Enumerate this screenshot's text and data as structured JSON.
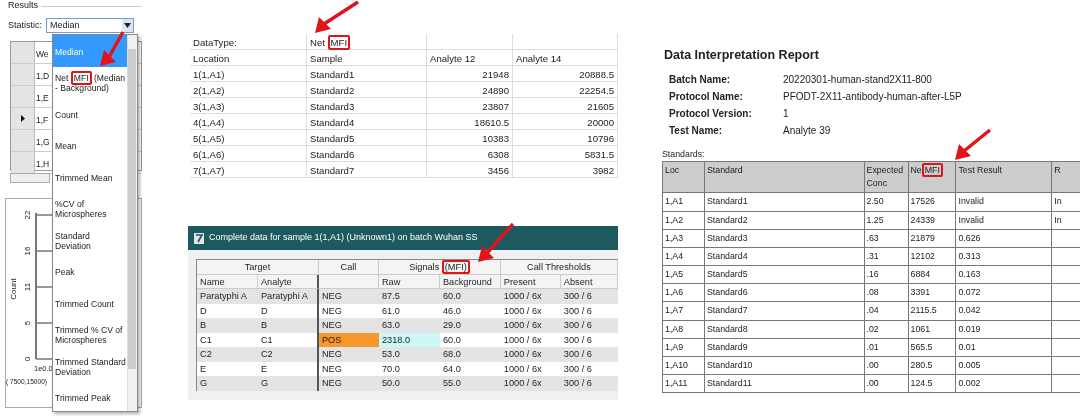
{
  "stats_panel": {
    "group_title": "Results",
    "statistic_label": "Statistic:",
    "statistic_value": "Median",
    "grid": {
      "column": "We",
      "rows": [
        {
          "label": "1,D",
          "current": false
        },
        {
          "label": "1,E",
          "current": false
        },
        {
          "label": "1,F",
          "current": true
        },
        {
          "label": "1,G",
          "current": false
        },
        {
          "label": "1,H",
          "current": false
        }
      ]
    },
    "histogram": {
      "y_label": "Count",
      "y_ticks": [
        "22",
        "16",
        "11",
        "5",
        "0"
      ],
      "x_tick": "1e0.0",
      "range": "( 7500,15000)"
    },
    "dropdown_items": [
      {
        "label": "Median",
        "selected": true
      },
      {
        "selected": false,
        "highlight": {
          "prefix": "Net ",
          "mark": "MFI",
          "suffix": " (Median - Background)"
        }
      },
      {
        "label": "Count",
        "selected": false
      },
      {
        "label": "Mean",
        "selected": false
      },
      {
        "label": "Trimmed Mean",
        "selected": false
      },
      {
        "label": "%CV of Microspheres",
        "selected": false
      },
      {
        "label": "Standard Deviation",
        "selected": false
      },
      {
        "label": "Peak",
        "selected": false
      },
      {
        "label": "Trimmed Count",
        "selected": false
      },
      {
        "label": "Trimmed % CV of Microspheres",
        "selected": false
      },
      {
        "label": "Trimmed Standard Deviation",
        "selected": false
      },
      {
        "label": "Trimmed Peak",
        "selected": false
      }
    ]
  },
  "export_sheet": {
    "data_type_label": "DataType:",
    "data_type_value": {
      "prefix": "Net ",
      "mark": "MFI"
    },
    "columns": [
      "Location",
      "Sample",
      "Analyte 12",
      "Analyte 14"
    ],
    "rows": [
      [
        "1(1,A1)",
        "Standard1",
        "21948",
        "20888.5"
      ],
      [
        "2(1,A2)",
        "Standard2",
        "24890",
        "22254.5"
      ],
      [
        "3(1,A3)",
        "Standard3",
        "23807",
        "21605"
      ],
      [
        "4(1,A4)",
        "Standard4",
        "18610.5",
        "20000"
      ],
      [
        "5(1,A5)",
        "Standard5",
        "10383",
        "10796"
      ],
      [
        "6(1,A6)",
        "Standard6",
        "6308",
        "5831.5"
      ],
      [
        "7(1,A7)",
        "Standard7",
        "3456",
        "3982"
      ]
    ]
  },
  "sample_window": {
    "title": "Complete data for sample 1(1,A1) (Unknown1) on batch Wuhan SS",
    "groups": [
      {
        "label": "Target"
      },
      {
        "label": "Call"
      },
      {
        "highlight": {
          "prefix": "Signals ",
          "mark": "(MFI)"
        }
      },
      {
        "label": "Call Thresholds"
      }
    ],
    "columns": [
      "Name",
      "Analyte",
      "",
      "Raw",
      "Background",
      "Present",
      "Absent"
    ],
    "rows": [
      {
        "name": "Paratyphi A",
        "analyte": "Paratyphi A",
        "call": "NEG",
        "positive": false,
        "raw": "87.5",
        "background": "60.0",
        "present": "1000 / 6x",
        "absent": "300 / 6"
      },
      {
        "name": "D",
        "analyte": "D",
        "call": "NEG",
        "positive": false,
        "raw": "61.0",
        "background": "46.0",
        "present": "1000 / 6x",
        "absent": "300 / 6"
      },
      {
        "name": "B",
        "analyte": "B",
        "call": "NEG",
        "positive": false,
        "raw": "63.0",
        "background": "29.0",
        "present": "1000 / 6x",
        "absent": "300 / 6"
      },
      {
        "name": "C1",
        "analyte": "C1",
        "call": "POS",
        "positive": true,
        "raw": "2318.0",
        "background": "60.0",
        "present": "1000 / 6x",
        "absent": "300 / 6"
      },
      {
        "name": "C2",
        "analyte": "C2",
        "call": "NEG",
        "positive": false,
        "raw": "53.0",
        "background": "68.0",
        "present": "1000 / 6x",
        "absent": "300 / 6"
      },
      {
        "name": "E",
        "analyte": "E",
        "call": "NEG",
        "positive": false,
        "raw": "70.0",
        "background": "64.0",
        "present": "1000 / 6x",
        "absent": "300 / 6"
      },
      {
        "name": "G",
        "analyte": "G",
        "call": "NEG",
        "positive": false,
        "raw": "50.0",
        "background": "55.0",
        "present": "1000 / 6x",
        "absent": "300 / 6"
      }
    ]
  },
  "report": {
    "title": "Data Interpretation Report",
    "fields": [
      {
        "label": "Batch Name:",
        "value": "20220301-human-stand2X11-800"
      },
      {
        "label": "Protocol Name:",
        "value": "PFODT-2X11-antibody-human-after-L5P"
      },
      {
        "label": "Protocol Version:",
        "value": "1"
      },
      {
        "label": "Test Name:",
        "value": "Analyte 39"
      }
    ],
    "standards_label": "Standards:",
    "columns": [
      {
        "label": "Loc"
      },
      {
        "label": "Standard"
      },
      {
        "label": "Expected Conc"
      },
      {
        "highlight": {
          "prefix": "Ne",
          "mark": "MFI"
        }
      },
      {
        "label": "Test Result"
      },
      {
        "label": "R"
      }
    ],
    "rows": [
      [
        "1,A1",
        "Standard1",
        "2.50",
        "17526",
        "Invalid",
        "In"
      ],
      [
        "1,A2",
        "Standard2",
        "1.25",
        "24339",
        "Invalid",
        "In"
      ],
      [
        "1,A3",
        "Standard3",
        ".63",
        "21879",
        "0.626"
      ],
      [
        "1,A4",
        "Standard4",
        ".31",
        "12102",
        "0.313"
      ],
      [
        "1,A5",
        "Standard5",
        ".16",
        "6884",
        "0.163"
      ],
      [
        "1,A6",
        "Standard6",
        ".08",
        "3391",
        "0.072"
      ],
      [
        "1,A7",
        "Standard7",
        ".04",
        "2115.5",
        "0.042"
      ],
      [
        "1,A8",
        "Standard8",
        ".02",
        "1061",
        "0.019"
      ],
      [
        "1,A9",
        "Standard9",
        ".01",
        "565.5",
        "0.01"
      ],
      [
        "1,A10",
        "Standard10",
        ".00",
        "280.5",
        "0.005"
      ],
      [
        "1,A11",
        "Standard11",
        ".00",
        "124.5",
        "0.002"
      ]
    ]
  }
}
